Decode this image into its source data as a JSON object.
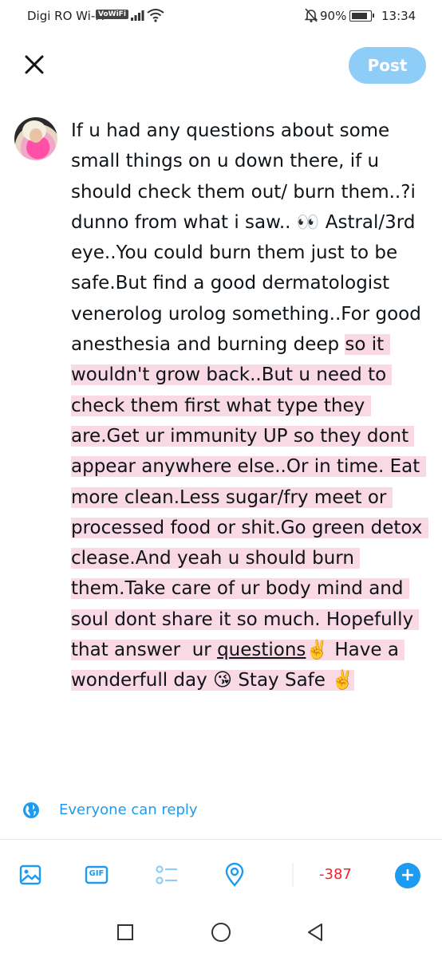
{
  "status_bar": {
    "carrier": "Digi RO Wi-Fi",
    "vowifi": "VoWiFi",
    "battery_text": "90%",
    "battery_level": 0.9,
    "time": "13:34"
  },
  "header": {
    "post_label": "Post"
  },
  "tweet": {
    "part1": "If u had any questions about some small things on u down there, if u should check them out/ burn them..?i dunno from what i saw.. 👀 Astral/3rd eye..You could burn them just to be safe.But find a good dermatologist venerolog urolog something..For good anesthesia and burning deep ",
    "part2": "so it wouldn't grow back..But u need to check them first what type they are.Get ur immunity UP so they dont appear anywhere else..Or in time. Eat more clean.Less sugar/fry meet or processed food or shit.Go green detox clease.And yeah u should burn them.Take care of ur body mind and soul dont share it so much. Hopefully that answer  ur ",
    "part3": "questions",
    "part4": "✌️ Have a wonderfull day 😘 Stay Safe ✌️"
  },
  "reply_setting": {
    "label": "Everyone can reply"
  },
  "toolbar": {
    "gif_label": "GIF",
    "char_count": "-387",
    "add_label": "+"
  },
  "colors": {
    "accent": "#1d9bf0",
    "post_button": "#8ecdf8",
    "highlight": "#f9d9e4",
    "over_limit": "#f4212e"
  }
}
